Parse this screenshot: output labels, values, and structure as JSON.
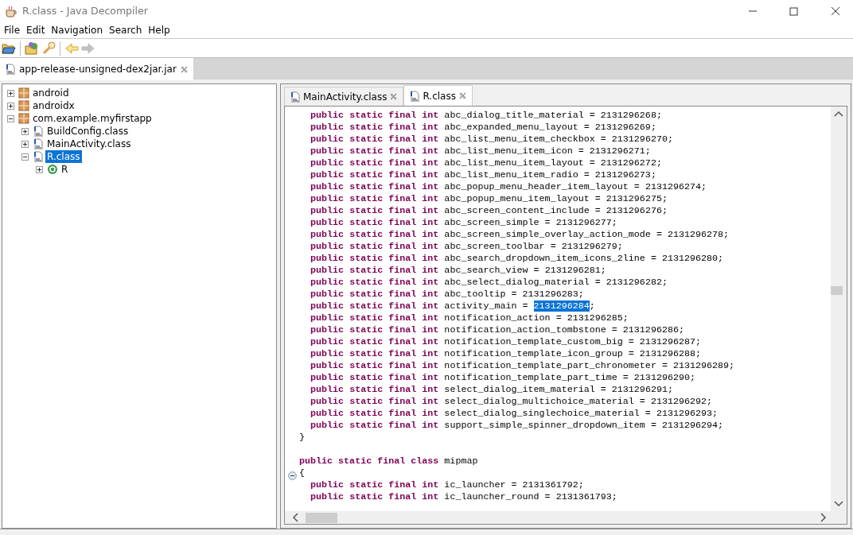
{
  "window": {
    "title": "R.class - Java Decompiler"
  },
  "menu": [
    "File",
    "Edit",
    "Navigation",
    "Search",
    "Help"
  ],
  "toolbar": [
    {
      "kind": "open"
    },
    {
      "kind": "open-type"
    },
    {
      "kind": "search"
    },
    {
      "kind": "sep"
    },
    {
      "kind": "back",
      "disabled": false
    },
    {
      "kind": "forward",
      "disabled": true
    }
  ],
  "file_tabs": [
    {
      "label": "app-release-unsigned-dex2jar.jar",
      "selected": true
    }
  ],
  "tree": [
    {
      "label": "android",
      "kind": "package",
      "expanded": false,
      "selected": false
    },
    {
      "label": "androidx",
      "kind": "package",
      "expanded": false,
      "selected": false
    },
    {
      "label": "com.example.myfirstapp",
      "kind": "package",
      "expanded": true,
      "selected": false,
      "children": [
        {
          "label": "BuildConfig.class",
          "kind": "file",
          "expanded": false,
          "selected": false
        },
        {
          "label": "MainActivity.class",
          "kind": "file",
          "expanded": false,
          "selected": false
        },
        {
          "label": "R.class",
          "kind": "file",
          "expanded": true,
          "selected": true,
          "children": [
            {
              "label": "R",
              "kind": "class",
              "expanded": false,
              "selected": false
            }
          ]
        }
      ]
    }
  ],
  "editor_tabs": [
    {
      "label": "MainActivity.class",
      "selected": false
    },
    {
      "label": "R.class",
      "selected": true
    }
  ],
  "code": [
    {
      "kind": "field",
      "keyword": "public static final int",
      "name": "abc_dialog_title_material =",
      "value": "2131296268;"
    },
    {
      "kind": "field",
      "keyword": "public static final int",
      "name": "abc_expanded_menu_layout =",
      "value": "2131296269;"
    },
    {
      "kind": "field",
      "keyword": "public static final int",
      "name": "abc_list_menu_item_checkbox =",
      "value": "2131296270;"
    },
    {
      "kind": "field",
      "keyword": "public static final int",
      "name": "abc_list_menu_item_icon =",
      "value": "2131296271;"
    },
    {
      "kind": "field",
      "keyword": "public static final int",
      "name": "abc_list_menu_item_layout =",
      "value": "2131296272;"
    },
    {
      "kind": "field",
      "keyword": "public static final int",
      "name": "abc_list_menu_item_radio =",
      "value": "2131296273;"
    },
    {
      "kind": "field",
      "keyword": "public static final int",
      "name": "abc_popup_menu_header_item_layout =",
      "value": "2131296274;"
    },
    {
      "kind": "field",
      "keyword": "public static final int",
      "name": "abc_popup_menu_item_layout =",
      "value": "2131296275;"
    },
    {
      "kind": "field",
      "keyword": "public static final int",
      "name": "abc_screen_content_include =",
      "value": "2131296276;"
    },
    {
      "kind": "field",
      "keyword": "public static final int",
      "name": "abc_screen_simple =",
      "value": "2131296277;"
    },
    {
      "kind": "field",
      "keyword": "public static final int",
      "name": "abc_screen_simple_overlay_action_mode =",
      "value": "2131296278;"
    },
    {
      "kind": "field",
      "keyword": "public static final int",
      "name": "abc_screen_toolbar =",
      "value": "2131296279;"
    },
    {
      "kind": "field",
      "keyword": "public static final int",
      "name": "abc_search_dropdown_item_icons_2line =",
      "value": "2131296280;"
    },
    {
      "kind": "field",
      "keyword": "public static final int",
      "name": "abc_search_view =",
      "value": "2131296281;"
    },
    {
      "kind": "field",
      "keyword": "public static final int",
      "name": "abc_select_dialog_material =",
      "value": "2131296282;"
    },
    {
      "kind": "field",
      "keyword": "public static final int",
      "name": "abc_tooltip =",
      "value": "2131296283;"
    },
    {
      "kind": "field",
      "keyword": "public static final int",
      "name": "activity_main =",
      "value": "2131296284",
      "tail": ";",
      "selected": true
    },
    {
      "kind": "field",
      "keyword": "public static final int",
      "name": "notification_action =",
      "value": "2131296285;"
    },
    {
      "kind": "field",
      "keyword": "public static final int",
      "name": "notification_action_tombstone =",
      "value": "2131296286;"
    },
    {
      "kind": "field",
      "keyword": "public static final int",
      "name": "notification_template_custom_big =",
      "value": "2131296287;"
    },
    {
      "kind": "field",
      "keyword": "public static final int",
      "name": "notification_template_icon_group =",
      "value": "2131296288;"
    },
    {
      "kind": "field",
      "keyword": "public static final int",
      "name": "notification_template_part_chronometer =",
      "value": "2131296289;"
    },
    {
      "kind": "field",
      "keyword": "public static final int",
      "name": "notification_template_part_time =",
      "value": "2131296290;"
    },
    {
      "kind": "field",
      "keyword": "public static final int",
      "name": "select_dialog_item_material =",
      "value": "2131296291;"
    },
    {
      "kind": "field",
      "keyword": "public static final int",
      "name": "select_dialog_multichoice_material =",
      "value": "2131296292;"
    },
    {
      "kind": "field",
      "keyword": "public static final int",
      "name": "select_dialog_singlechoice_material =",
      "value": "2131296293;"
    },
    {
      "kind": "field",
      "keyword": "public static final int",
      "name": "support_simple_spinner_dropdown_item =",
      "value": "2131296294;"
    },
    {
      "kind": "brace",
      "text": "}"
    },
    {
      "kind": "blank"
    },
    {
      "kind": "class",
      "keyword": "public static final class",
      "name": "mipmap"
    },
    {
      "kind": "brace",
      "text": "{",
      "folded": false
    },
    {
      "kind": "field",
      "keyword": "public static final int",
      "name": "ic_launcher =",
      "value": "2131361792;"
    },
    {
      "kind": "field",
      "keyword": "public static final int",
      "name": "ic_launcher_round =",
      "value": "2131361793;"
    }
  ]
}
